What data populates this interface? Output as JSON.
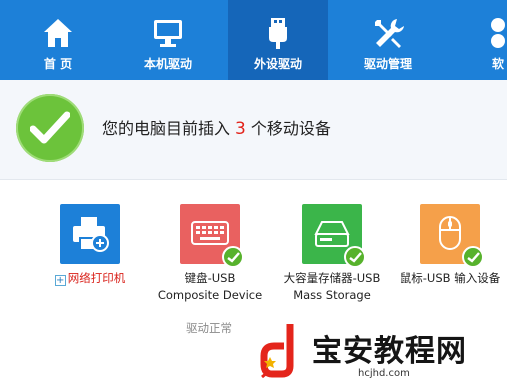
{
  "nav": {
    "items": [
      {
        "label": "首 页",
        "icon": "home-icon"
      },
      {
        "label": "本机驱动",
        "icon": "monitor-icon"
      },
      {
        "label": "外设驱动",
        "icon": "usb-icon",
        "active": true
      },
      {
        "label": "驱动管理",
        "icon": "tools-icon"
      },
      {
        "label": "软",
        "icon": "software-icon"
      }
    ]
  },
  "status": {
    "prefix": "您的电脑目前插入",
    "count": "3",
    "suffix": "个移动设备"
  },
  "devices": [
    {
      "label_line1": "网络打印机",
      "label_line2": "",
      "icon": "printer-add-icon",
      "tile_color": "#1d80d8",
      "status": "not-installed"
    },
    {
      "label_line1": "键盘-USB",
      "label_line2": "Composite Device",
      "icon": "keyboard-icon",
      "tile_color": "#e96160",
      "status": "ok"
    },
    {
      "label_line1": "大容量存储器-USB",
      "label_line2": "Mass Storage",
      "icon": "storage-drive-icon",
      "tile_color": "#3bb54a",
      "status": "ok"
    },
    {
      "label_line1": "鼠标-USB 输入设备",
      "label_line2": "",
      "icon": "mouse-icon",
      "tile_color": "#f5a04a",
      "status": "ok"
    }
  ],
  "section_note": "驱动正常",
  "watermark": {
    "title": "宝安教程网",
    "url": "hcjhd.com"
  },
  "colors": {
    "nav_bg": "#1d80d8",
    "nav_active": "#1566b9",
    "accent_red": "#e2231a",
    "ok_green": "#57b22c"
  }
}
